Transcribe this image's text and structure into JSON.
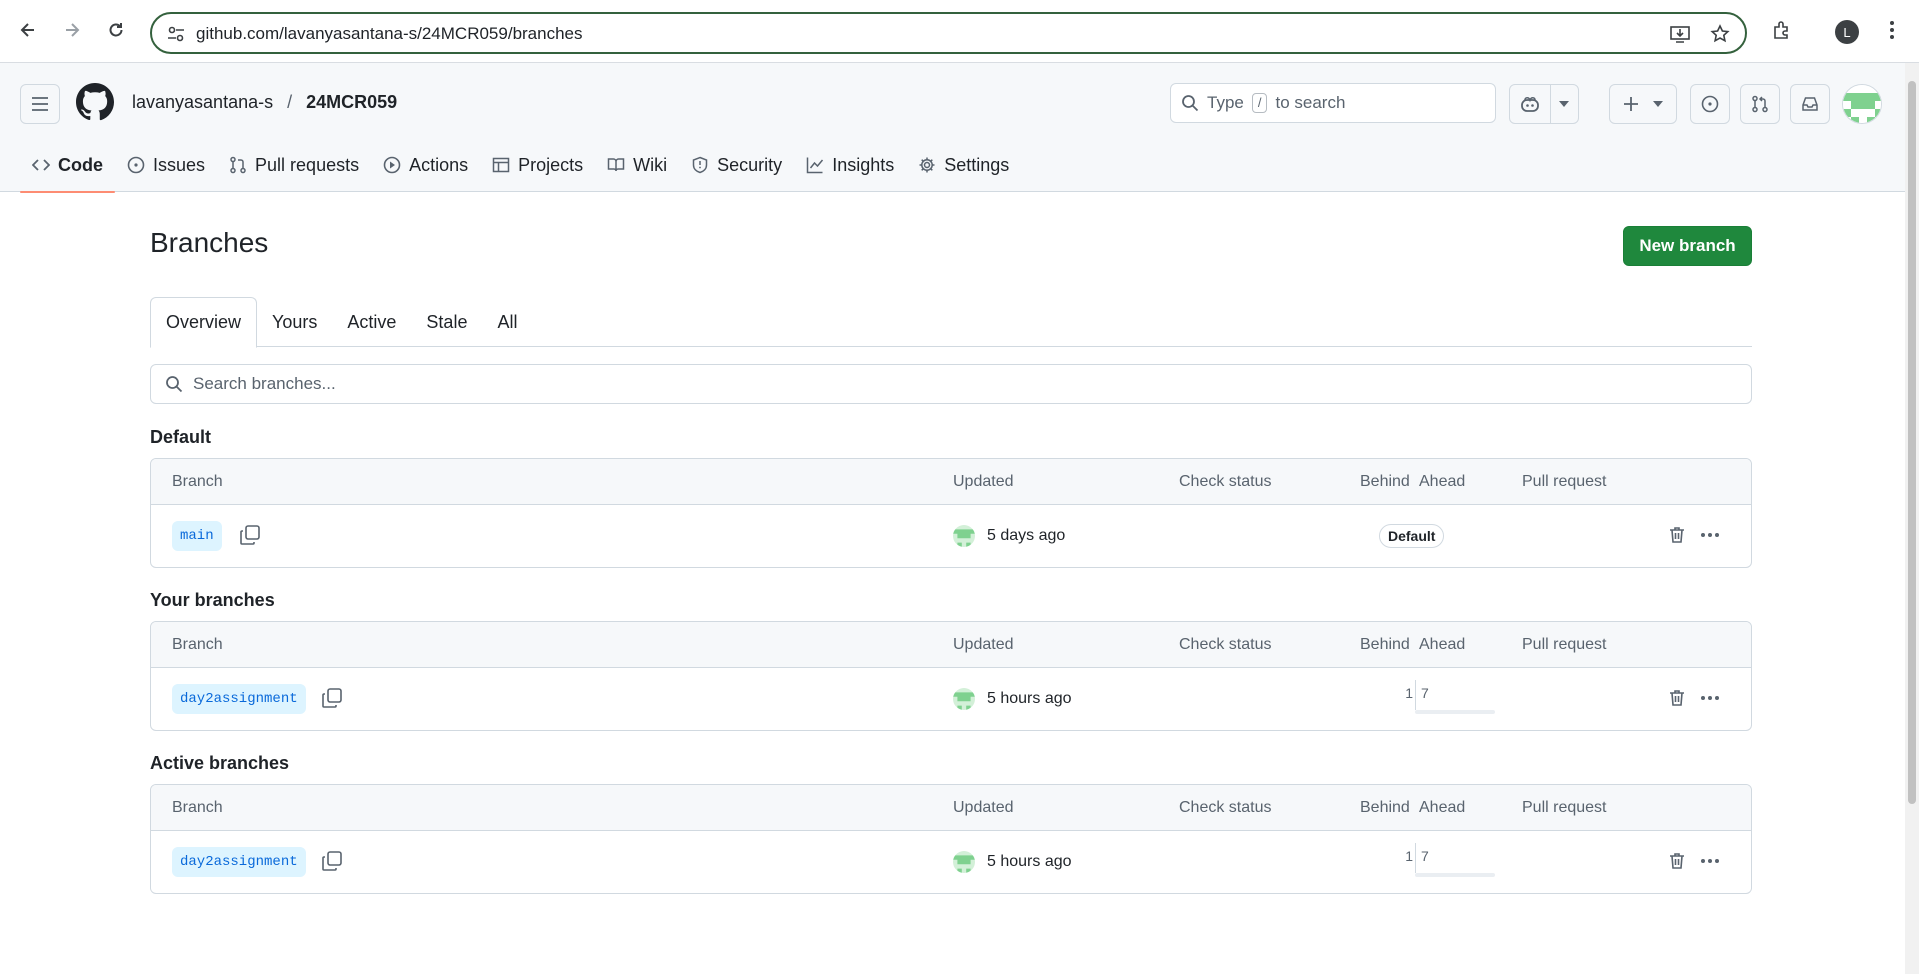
{
  "browser": {
    "url": "github.com/lavanyasantana-s/24MCR059/branches",
    "profile_initial": "L"
  },
  "header": {
    "owner": "lavanyasantana-s",
    "separator": "/",
    "repo": "24MCR059",
    "search_prefix": "Type",
    "search_key": "/",
    "search_suffix": "to search"
  },
  "repo_tabs": [
    {
      "label": "Code",
      "icon": "code-icon"
    },
    {
      "label": "Issues",
      "icon": "issue-icon"
    },
    {
      "label": "Pull requests",
      "icon": "pull-request-icon"
    },
    {
      "label": "Actions",
      "icon": "play-icon"
    },
    {
      "label": "Projects",
      "icon": "table-icon"
    },
    {
      "label": "Wiki",
      "icon": "book-icon"
    },
    {
      "label": "Security",
      "icon": "shield-icon"
    },
    {
      "label": "Insights",
      "icon": "graph-icon"
    },
    {
      "label": "Settings",
      "icon": "gear-icon"
    }
  ],
  "page": {
    "title": "Branches",
    "new_branch_label": "New branch",
    "subtabs": [
      "Overview",
      "Yours",
      "Active",
      "Stale",
      "All"
    ],
    "search_placeholder": "Search branches..."
  },
  "columns": {
    "branch": "Branch",
    "updated": "Updated",
    "check_status": "Check status",
    "behind": "Behind",
    "ahead": "Ahead",
    "pull_request": "Pull request"
  },
  "sections": [
    {
      "title": "Default",
      "branch": "main",
      "updated": "5 days ago",
      "badge": "Default"
    },
    {
      "title": "Your branches",
      "branch": "day2assignment",
      "updated": "5 hours ago",
      "behind": "1",
      "ahead": "7"
    },
    {
      "title": "Active branches",
      "branch": "day2assignment",
      "updated": "5 hours ago",
      "behind": "1",
      "ahead": "7"
    }
  ],
  "colors": {
    "primary_button": "#1f883d",
    "branch_pill_bg": "#ddf4ff",
    "branch_pill_text": "#0969da",
    "active_tab_underline": "#fd8c73"
  }
}
